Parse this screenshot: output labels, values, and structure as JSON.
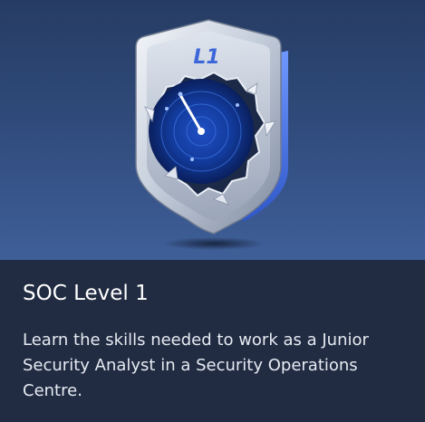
{
  "badge": {
    "level_text": "L1",
    "icon": "radar-icon"
  },
  "card": {
    "title": "SOC Level 1",
    "description": "Learn the skills needed to work as a Junior Security Analyst in a Security Operations Centre."
  },
  "colors": {
    "card_background": "#212C42",
    "hero_top": "#263C63",
    "hero_bottom": "#3F5F99",
    "title_text": "#FFFFFF",
    "description_text": "#E6EAF2",
    "badge_accent": "#3D66D9"
  }
}
